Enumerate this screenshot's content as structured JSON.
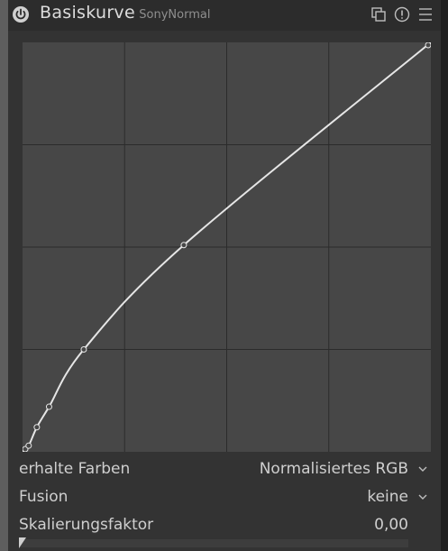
{
  "header": {
    "title": "Basiskurve",
    "preset": "· SonyNormal",
    "icons": [
      "power-icon",
      "multi-instance-icon",
      "reset-icon",
      "presets-menu-icon"
    ]
  },
  "curve": {
    "grid_divisions": 4,
    "nodes": [
      [
        0.0,
        0.0
      ],
      [
        0.015,
        0.015
      ],
      [
        0.035,
        0.06
      ],
      [
        0.065,
        0.11
      ],
      [
        0.15,
        0.25
      ],
      [
        0.395,
        0.505
      ],
      [
        1.0,
        1.0
      ]
    ],
    "line_color": "#e6e6e6",
    "grid_color": "#2b2b2b",
    "background": "#474747"
  },
  "controls": {
    "preserve_colors": {
      "label": "erhalte Farben",
      "value": "Normalisiertes RGB"
    },
    "fusion": {
      "label": "Fusion",
      "value": "keine"
    },
    "scale": {
      "label": "Skalierungsfaktor",
      "value": "0,00"
    }
  }
}
